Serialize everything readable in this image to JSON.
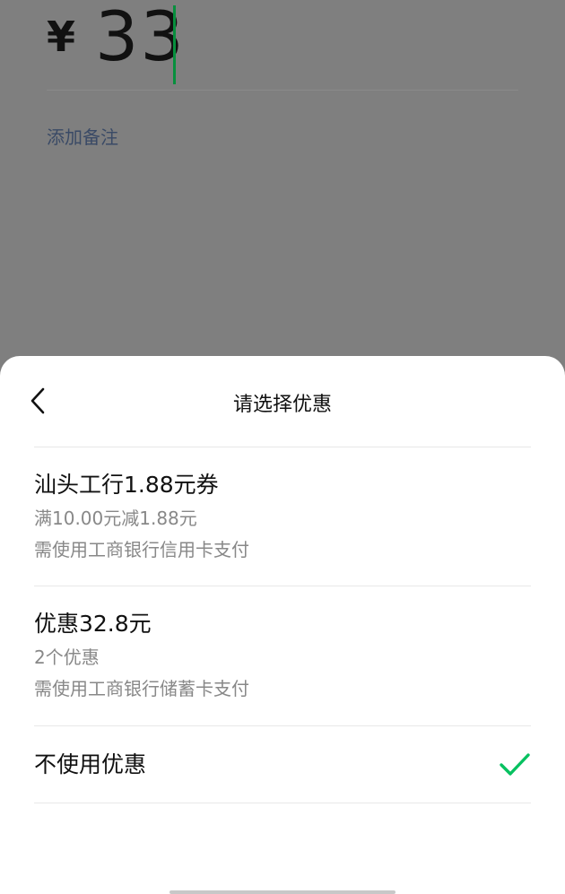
{
  "background": {
    "currency_symbol": "¥",
    "amount": "33",
    "add_note_label": "添加备注"
  },
  "sheet": {
    "title": "请选择优惠",
    "back_icon": "chevron-left-icon",
    "options": [
      {
        "title": "汕头工行1.88元券",
        "detail": "满10.00元减1.88元",
        "requirement": "需使用工商银行信用卡支付",
        "selected": false
      },
      {
        "title": "优惠32.8元",
        "detail": "2个优惠",
        "requirement": "需使用工商银行储蓄卡支付",
        "selected": false
      },
      {
        "title": "不使用优惠",
        "selected": true
      }
    ],
    "check_icon": "checkmark-icon"
  },
  "colors": {
    "overlay": "#7f7f7f",
    "accent_green": "#07c160",
    "caret_green": "#078f3d",
    "note_link": "#3a4a66",
    "secondary_text": "#888888"
  }
}
